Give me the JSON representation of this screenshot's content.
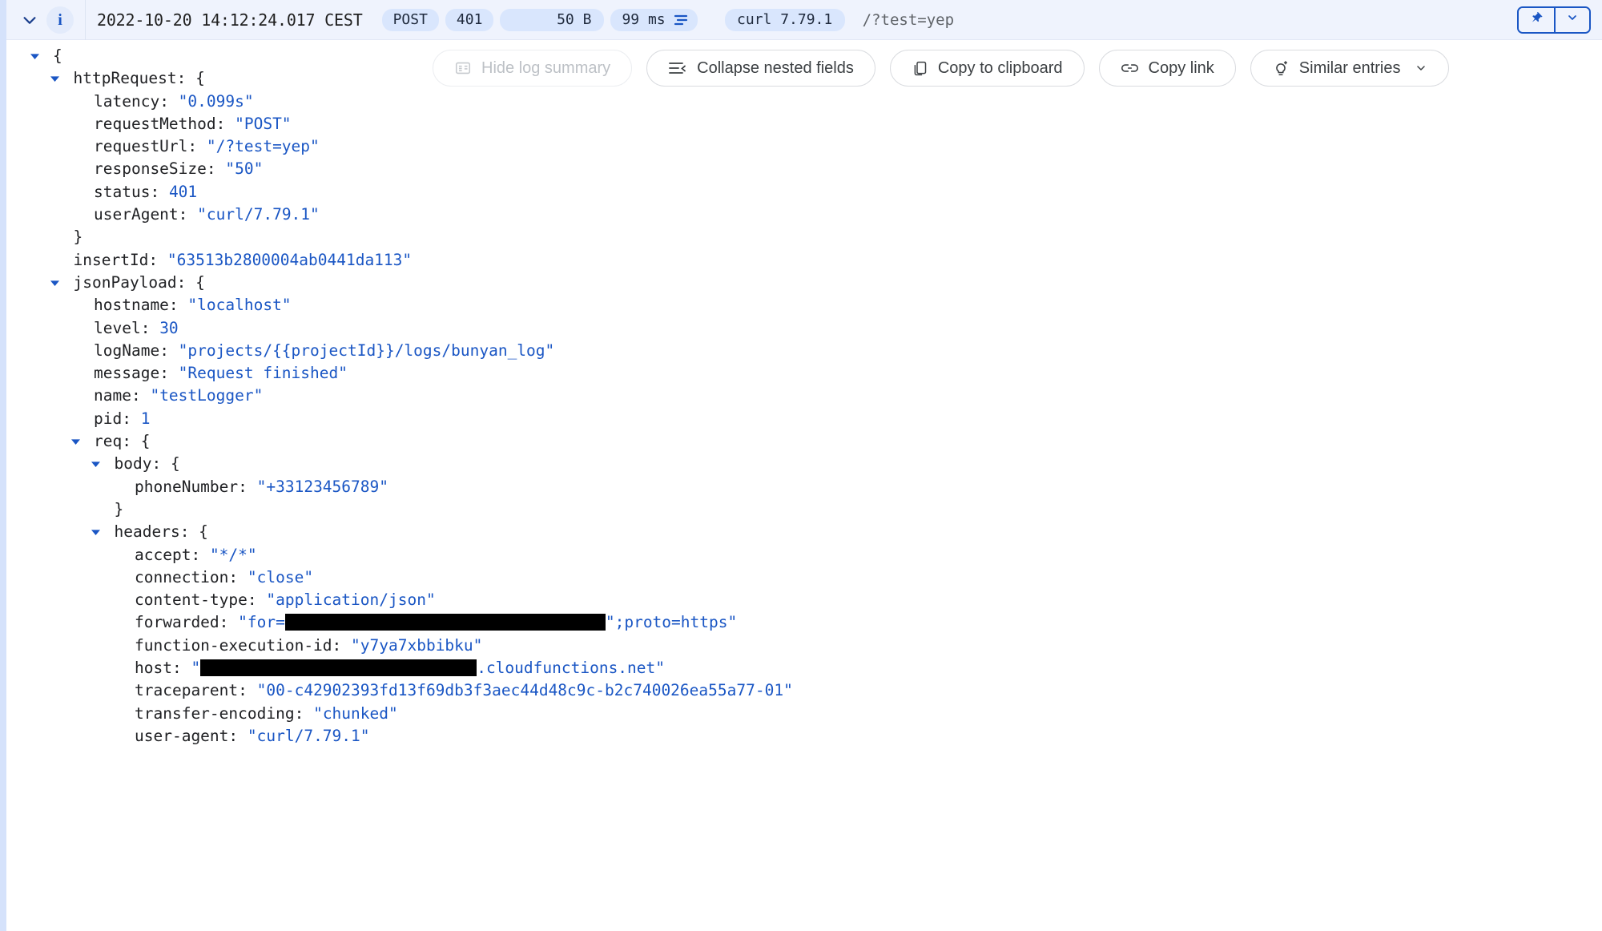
{
  "header": {
    "expand_icon": "chevron-down-icon",
    "severity_icon": "info-icon",
    "severity_letter": "i",
    "timestamp": "2022-10-20 14:12:24.017 CEST",
    "chips": {
      "method": "POST",
      "status": "401",
      "size": "50 B",
      "latency": "99 ms",
      "latency_icon": "latency-bars-icon",
      "user_agent": "curl 7.79.1"
    },
    "url": "/?test=yep",
    "pin_icon": "pin-icon",
    "menu_icon": "chevron-down-icon"
  },
  "toolbar": {
    "hide_log_summary": "Hide log summary",
    "hide_log_summary_icon": "summary-icon",
    "collapse_nested_fields": "Collapse nested fields",
    "collapse_nested_fields_icon": "collapse-icon",
    "copy_to_clipboard": "Copy to clipboard",
    "copy_to_clipboard_icon": "copy-icon",
    "copy_link": "Copy link",
    "copy_link_icon": "link-icon",
    "similar_entries": "Similar entries",
    "similar_entries_icon": "lightbulb-icon",
    "similar_entries_caret": "chevron-down-icon"
  },
  "json_lines": [
    {
      "indent": 0,
      "toggle": "open",
      "key": "",
      "punct": "{"
    },
    {
      "indent": 1,
      "toggle": "open",
      "key": "httpRequest",
      "punct": ": {"
    },
    {
      "indent": 2,
      "key": "latency",
      "punct": ": ",
      "value": "\"0.099s\""
    },
    {
      "indent": 2,
      "key": "requestMethod",
      "punct": ": ",
      "value": "\"POST\""
    },
    {
      "indent": 2,
      "key": "requestUrl",
      "punct": ": ",
      "value": "\"/?test=yep\""
    },
    {
      "indent": 2,
      "key": "responseSize",
      "punct": ": ",
      "value": "\"50\""
    },
    {
      "indent": 2,
      "key": "status",
      "punct": ": ",
      "value": "401"
    },
    {
      "indent": 2,
      "key": "userAgent",
      "punct": ": ",
      "value": "\"curl/7.79.1\""
    },
    {
      "indent": 1,
      "key": "",
      "punct": "}"
    },
    {
      "indent": 1,
      "key": "insertId",
      "punct": ": ",
      "value": "\"63513b2800004ab0441da113\""
    },
    {
      "indent": 1,
      "toggle": "open",
      "key": "jsonPayload",
      "punct": ": {"
    },
    {
      "indent": 2,
      "key": "hostname",
      "punct": ": ",
      "value": "\"localhost\""
    },
    {
      "indent": 2,
      "key": "level",
      "punct": ": ",
      "value": "30"
    },
    {
      "indent": 2,
      "key": "logName",
      "punct": ": ",
      "value": "\"projects/{{projectId}}/logs/bunyan_log\""
    },
    {
      "indent": 2,
      "key": "message",
      "punct": ": ",
      "value": "\"Request finished\""
    },
    {
      "indent": 2,
      "key": "name",
      "punct": ": ",
      "value": "\"testLogger\""
    },
    {
      "indent": 2,
      "key": "pid",
      "punct": ": ",
      "value": "1"
    },
    {
      "indent": 2,
      "toggle": "open",
      "key": "req",
      "punct": ": {"
    },
    {
      "indent": 3,
      "toggle": "open",
      "key": "body",
      "punct": ": {"
    },
    {
      "indent": 4,
      "key": "phoneNumber",
      "punct": ": ",
      "value": "\"+33123456789\""
    },
    {
      "indent": 3,
      "key": "",
      "punct": "}"
    },
    {
      "indent": 3,
      "toggle": "open",
      "key": "headers",
      "punct": ": {"
    },
    {
      "indent": 4,
      "key": "accept",
      "punct": ": ",
      "value": "\"*/*\""
    },
    {
      "indent": 4,
      "key": "connection",
      "punct": ": ",
      "value": "\"close\""
    },
    {
      "indent": 4,
      "key": "content-type",
      "punct": ": ",
      "value": "\"application/json\""
    },
    {
      "indent": 4,
      "key": "forwarded",
      "punct": ": ",
      "value": "\"for=",
      "redact": 400,
      "value_after": "\";proto=https\""
    },
    {
      "indent": 4,
      "key": "function-execution-id",
      "punct": ": ",
      "value": "\"y7ya7xbbibku\""
    },
    {
      "indent": 4,
      "key": "host",
      "punct": ": ",
      "value": "\"",
      "redact": 345,
      "value_after": ".cloudfunctions.net\""
    },
    {
      "indent": 4,
      "key": "traceparent",
      "punct": ": ",
      "value": "\"00-c42902393fd13f69db3f3aec44d48c9c-b2c740026ea55a77-01\""
    },
    {
      "indent": 4,
      "key": "transfer-encoding",
      "punct": ": ",
      "value": "\"chunked\""
    },
    {
      "indent": 4,
      "key": "user-agent",
      "punct": ": ",
      "value": "\"curl/7.79.1\""
    }
  ],
  "colors": {
    "accent": "#1a56c4",
    "value_blue": "#1a56c4",
    "key_text": "#202124",
    "header_bg": "#eff3fd",
    "chip_bg": "#d9e6fd",
    "rail": "#d5e2fb"
  }
}
